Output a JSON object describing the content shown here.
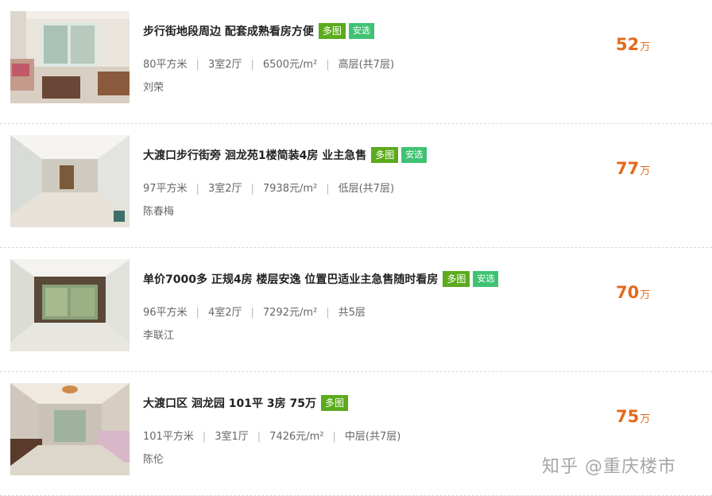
{
  "listings": [
    {
      "title": "步行街地段周边 配套成熟看房方便",
      "tags": {
        "photos": "多图",
        "safe": "安选"
      },
      "area": "80平方米",
      "layout": "3室2厅",
      "unit_price": "6500元/m²",
      "floor": "高层(共7层)",
      "agent": "刘荣",
      "price": "52",
      "price_unit": "万"
    },
    {
      "title": "大渡口步行街旁 洄龙苑1楼简装4房 业主急售",
      "tags": {
        "photos": "多图",
        "safe": "安选"
      },
      "area": "97平方米",
      "layout": "3室2厅",
      "unit_price": "7938元/m²",
      "floor": "低层(共7层)",
      "agent": "陈春梅",
      "price": "77",
      "price_unit": "万"
    },
    {
      "title": "单价7000多 正规4房 楼层安逸 位置巴适业主急售随时看房",
      "tags": {
        "photos": "多图",
        "safe": "安选"
      },
      "area": "96平方米",
      "layout": "4室2厅",
      "unit_price": "7292元/m²",
      "floor": "共5层",
      "agent": "李联江",
      "price": "70",
      "price_unit": "万"
    },
    {
      "title": "大渡口区 洄龙园 101平 3房 75万",
      "tags": {
        "photos": "多图"
      },
      "area": "101平方米",
      "layout": "3室1厅",
      "unit_price": "7426元/m²",
      "floor": "中层(共7层)",
      "agent": "陈伦",
      "price": "75",
      "price_unit": "万"
    }
  ],
  "watermark": "知乎 @重庆楼市"
}
